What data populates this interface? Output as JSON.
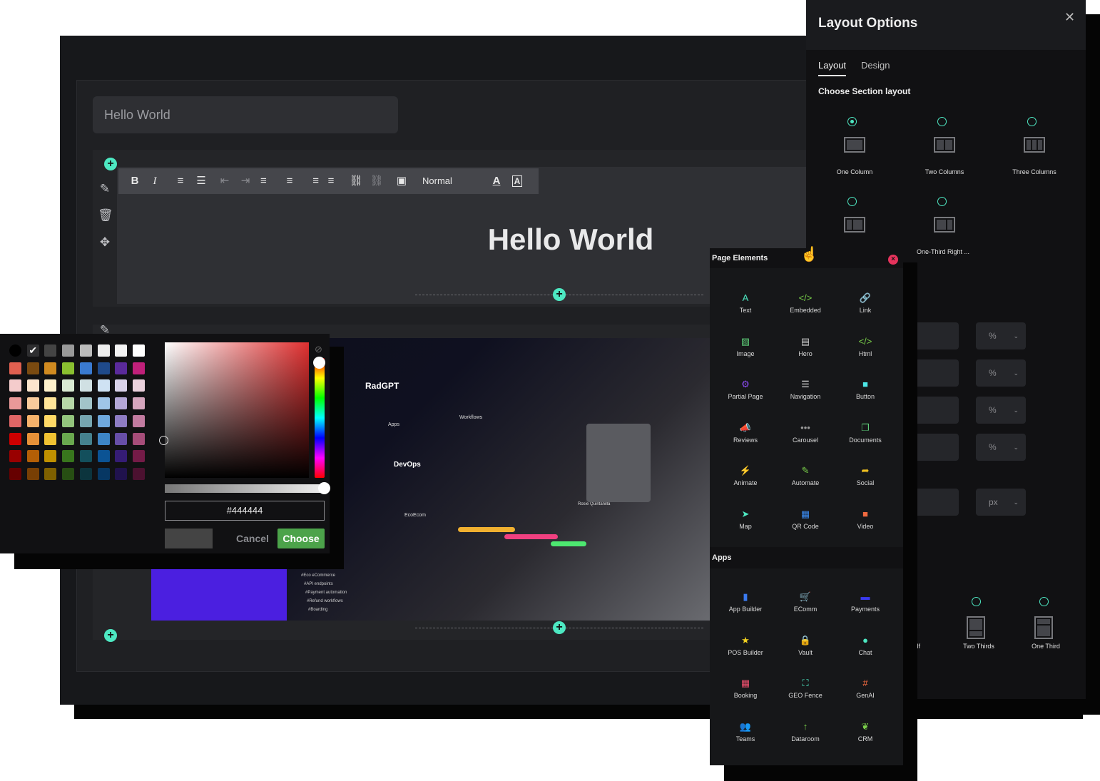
{
  "editor": {
    "title_value": "Hello World",
    "heading": "Hello World",
    "toolbar": {
      "bold": "B",
      "italic": "I",
      "ordered_list": "≡",
      "bullet_list": "☰",
      "outdent": "⇤",
      "indent": "⇥",
      "align_left": "≡",
      "align_center": "≡",
      "align_right": "≡",
      "justify": "≡",
      "link": "⛓",
      "unlink": "⛓",
      "image": "▣",
      "format": "Normal",
      "text_color": "A",
      "bg_color": "A"
    }
  },
  "color_picker": {
    "hex_value": "#444444",
    "preview_color": "#444444",
    "cancel_label": "Cancel",
    "choose_label": "Choose",
    "palette": [
      [
        "#000000",
        "#ffffff",
        "#444444",
        "#999999",
        "#bbbbbb",
        "#eeeeee",
        "#f3f3f3",
        "#ffffff"
      ],
      [
        "#e06050",
        "#7a4a10",
        "#d08a20",
        "#8abf30",
        "#3a7ad0",
        "#1f4a8a",
        "#5a2a9a",
        "#c0207a"
      ],
      [
        "#f4cccc",
        "#fce5cd",
        "#fff2cc",
        "#d9ead3",
        "#d0e0e3",
        "#cfe2f3",
        "#d9d2e9",
        "#ead1dc"
      ],
      [
        "#ea9999",
        "#f9cb9c",
        "#ffe599",
        "#b6d7a8",
        "#a2c4c9",
        "#9fc5e8",
        "#b4a7d6",
        "#d5a6bd"
      ],
      [
        "#e06666",
        "#f6b26b",
        "#ffd966",
        "#93c47d",
        "#76a5af",
        "#6fa8dc",
        "#8e7cc3",
        "#c27ba0"
      ],
      [
        "#cc0000",
        "#e69138",
        "#f1c232",
        "#6aa84f",
        "#45818e",
        "#3d85c6",
        "#674ea7",
        "#a64d79"
      ],
      [
        "#990000",
        "#b45f06",
        "#bf9000",
        "#38761d",
        "#134f5c",
        "#0b5394",
        "#351c75",
        "#741b47"
      ],
      [
        "#660000",
        "#783f04",
        "#7f6000",
        "#274e13",
        "#0c343d",
        "#073763",
        "#20124d",
        "#4c1130"
      ]
    ]
  },
  "layout_options": {
    "title": "Layout Options",
    "close_icon": "✕",
    "tabs": [
      "Layout",
      "Design"
    ],
    "active_tab": "Layout",
    "subtitle": "Choose Section layout",
    "options": [
      {
        "label": "One Column",
        "selected": true
      },
      {
        "label": "Two Columns",
        "selected": false
      },
      {
        "label": "Three Columns",
        "selected": false
      },
      {
        "label": "",
        "selected": false
      },
      {
        "label": "One-Third Right ...",
        "selected": false
      }
    ],
    "units": [
      "%",
      "%",
      "%",
      "%",
      "px"
    ],
    "bottom_options": [
      {
        "label": "alf"
      },
      {
        "label": "Two Thirds"
      },
      {
        "label": "One Third"
      }
    ]
  },
  "page_elements": {
    "title": "Page Elements",
    "elements": [
      {
        "label": "Text",
        "icon": "A",
        "color": "#4de8c2"
      },
      {
        "label": "Embedded",
        "icon": "</>",
        "color": "#7ad04a"
      },
      {
        "label": "Link",
        "icon": "🔗",
        "color": "#f0506e"
      },
      {
        "label": "Image",
        "icon": "▨",
        "color": "#5fd07a"
      },
      {
        "label": "Hero",
        "icon": "▤",
        "color": "#c8c8c8"
      },
      {
        "label": "Html",
        "icon": "</>",
        "color": "#7ad04a"
      },
      {
        "label": "Partial Page",
        "icon": "⚙",
        "color": "#8a4af0"
      },
      {
        "label": "Navigation",
        "icon": "☰",
        "color": "#d8d8d8"
      },
      {
        "label": "Button",
        "icon": "■",
        "color": "#4de8e8"
      },
      {
        "label": "Reviews",
        "icon": "📣",
        "color": "#f0506e"
      },
      {
        "label": "Carousel",
        "icon": "•••",
        "color": "#9a9a9a"
      },
      {
        "label": "Documents",
        "icon": "❐",
        "color": "#5fd07a"
      },
      {
        "label": "Animate",
        "icon": "⚡",
        "color": "#f0d020"
      },
      {
        "label": "Automate",
        "icon": "✎",
        "color": "#7ad04a"
      },
      {
        "label": "Social",
        "icon": "➦",
        "color": "#f0c020"
      },
      {
        "label": "Map",
        "icon": "➤",
        "color": "#4de8c2"
      },
      {
        "label": "QR Code",
        "icon": "▦",
        "color": "#3a8af0"
      },
      {
        "label": "Video",
        "icon": "■",
        "color": "#f06a40"
      }
    ],
    "apps_title": "Apps",
    "apps": [
      {
        "label": "App Builder",
        "icon": "▮",
        "color": "#3a7af0"
      },
      {
        "label": "EComm",
        "icon": "🛒",
        "color": "#7ad04a"
      },
      {
        "label": "Payments",
        "icon": "▬",
        "color": "#3a3af0"
      },
      {
        "label": "POS Builder",
        "icon": "★",
        "color": "#f0d020"
      },
      {
        "label": "Vault",
        "icon": "🔒",
        "color": "#8a4af0"
      },
      {
        "label": "Chat",
        "icon": "●",
        "color": "#4de8c2"
      },
      {
        "label": "Booking",
        "icon": "▦",
        "color": "#f0506e"
      },
      {
        "label": "GEO Fence",
        "icon": "⛶",
        "color": "#4de8c2"
      },
      {
        "label": "GenAI",
        "icon": "#",
        "color": "#f06a40"
      },
      {
        "label": "Teams",
        "icon": "👥",
        "color": "#8a4af0"
      },
      {
        "label": "Dataroom",
        "icon": "↑",
        "color": "#7ad04a"
      },
      {
        "label": "CRM",
        "icon": "❦",
        "color": "#7ad04a"
      }
    ]
  },
  "preview": {
    "brand": "RadGPT",
    "apps_label": "Apps",
    "workflows_label": "Workflows",
    "devops_label": "DevOps",
    "ecoecom_label": "EcoEcom",
    "person_name": "Rosie Quintanilla",
    "tags": [
      "#Eco eCommerce",
      "#API endpoints",
      "#Payment automation",
      "#Refund workflows",
      "#Boarding"
    ]
  }
}
